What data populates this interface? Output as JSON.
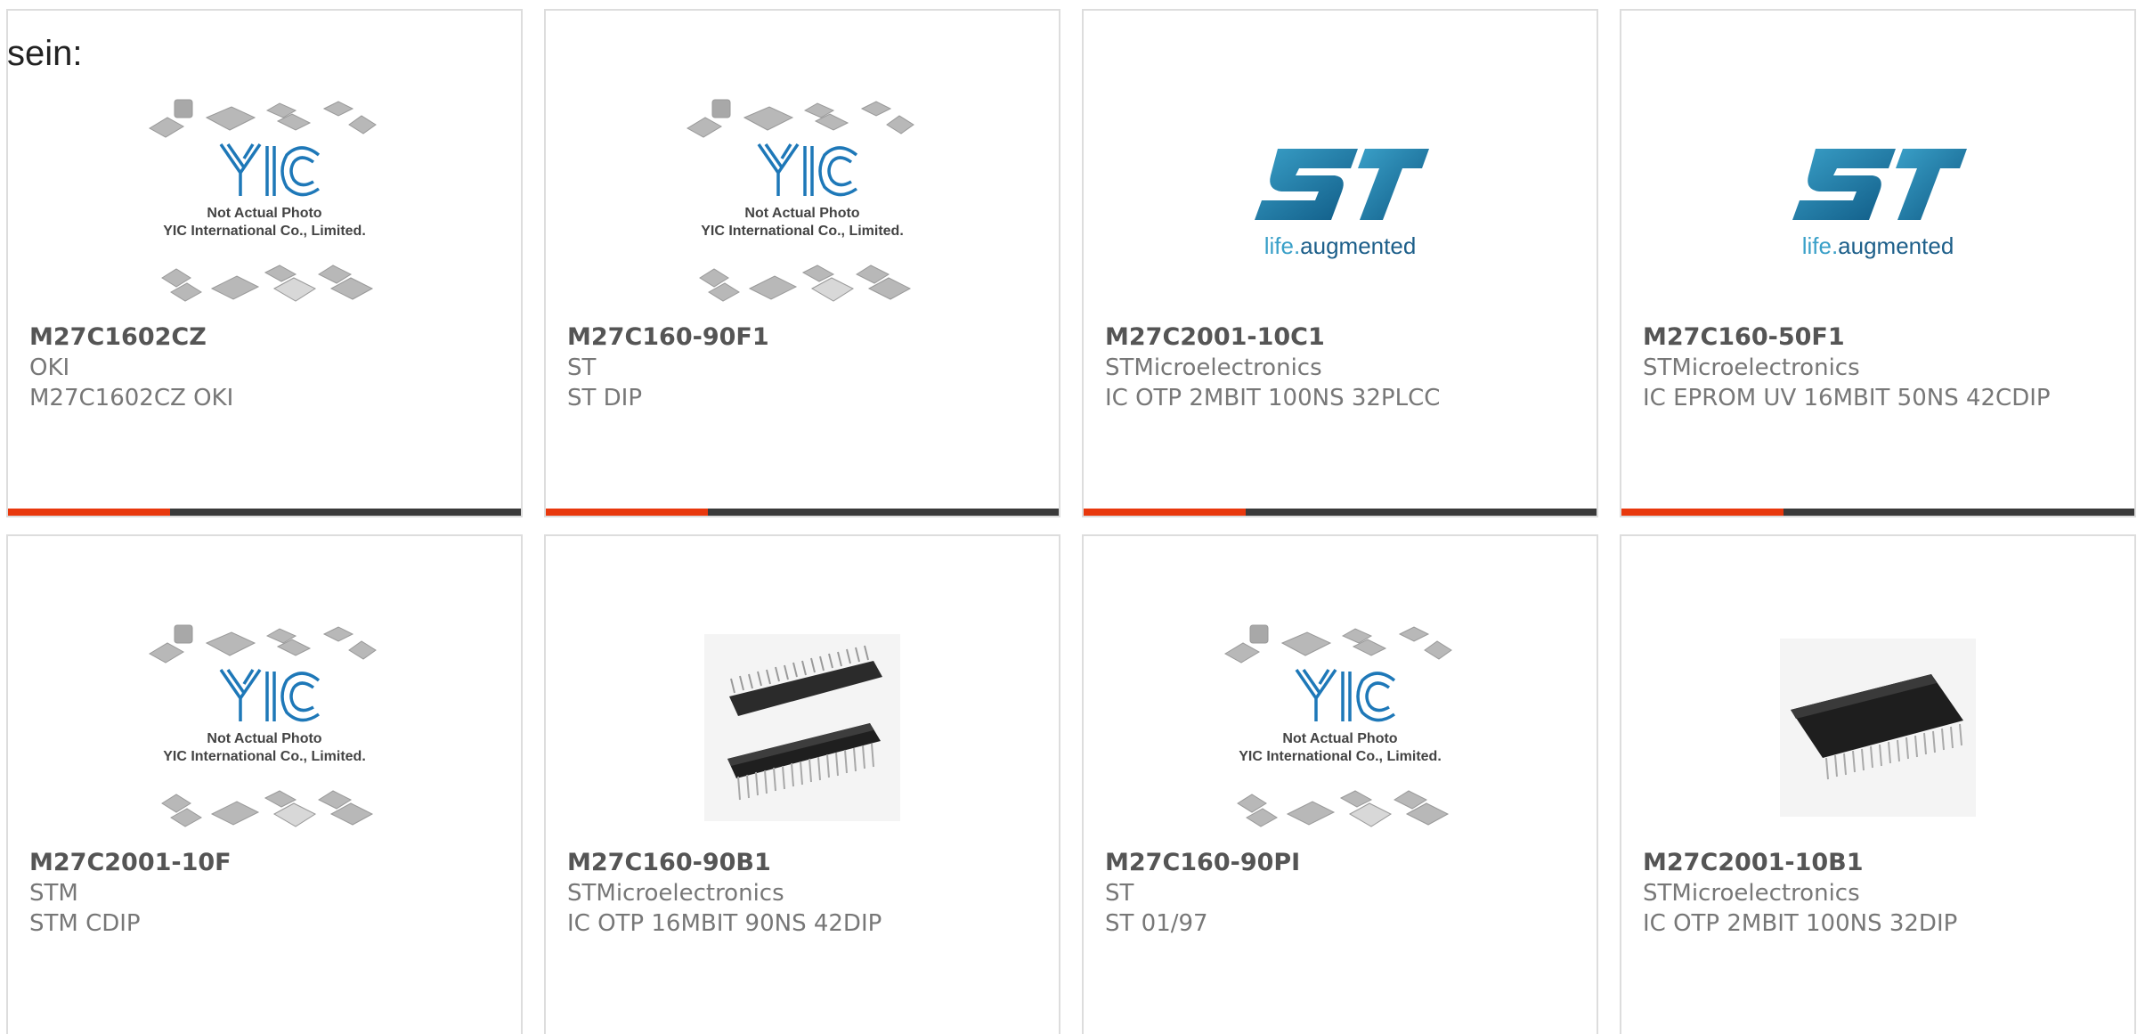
{
  "intro_text": "sein:",
  "colors": {
    "accent": "#e8380d",
    "bar": "#3a3a3a",
    "border": "#dddddd",
    "yic_blue": "#1e78b8",
    "st_blue": "#1d6f9c"
  },
  "placeholder": {
    "line1": "Not Actual Photo",
    "line2": "YIC International Co., Limited.",
    "logo": "YIC"
  },
  "st_logo": {
    "mark": "ST",
    "tagline_1": "life.",
    "tagline_2": "augmented"
  },
  "products": [
    {
      "part": "M27C1602CZ",
      "manufacturer": "OKI",
      "description": "M27C1602CZ OKI",
      "image": "yic-placeholder"
    },
    {
      "part": "M27C160-90F1",
      "manufacturer": "ST",
      "description": "ST DIP",
      "image": "yic-placeholder"
    },
    {
      "part": "M27C2001-10C1",
      "manufacturer": "STMicroelectronics",
      "description": "IC OTP 2MBIT 100NS 32PLCC",
      "image": "st-logo"
    },
    {
      "part": "M27C160-50F1",
      "manufacturer": "STMicroelectronics",
      "description": "IC EPROM UV 16MBIT 50NS 42CDIP",
      "image": "st-logo"
    },
    {
      "part": "M27C2001-10F",
      "manufacturer": "STM",
      "description": "STM CDIP",
      "image": "yic-placeholder"
    },
    {
      "part": "M27C160-90B1",
      "manufacturer": "STMicroelectronics",
      "description": "IC OTP 16MBIT 90NS 42DIP",
      "image": "dual-dip-chips"
    },
    {
      "part": "M27C160-90PI",
      "manufacturer": "ST",
      "description": "ST 01/97",
      "image": "yic-placeholder"
    },
    {
      "part": "M27C2001-10B1",
      "manufacturer": "STMicroelectronics",
      "description": "IC OTP 2MBIT 100NS 32DIP",
      "image": "single-dip-chip"
    }
  ]
}
